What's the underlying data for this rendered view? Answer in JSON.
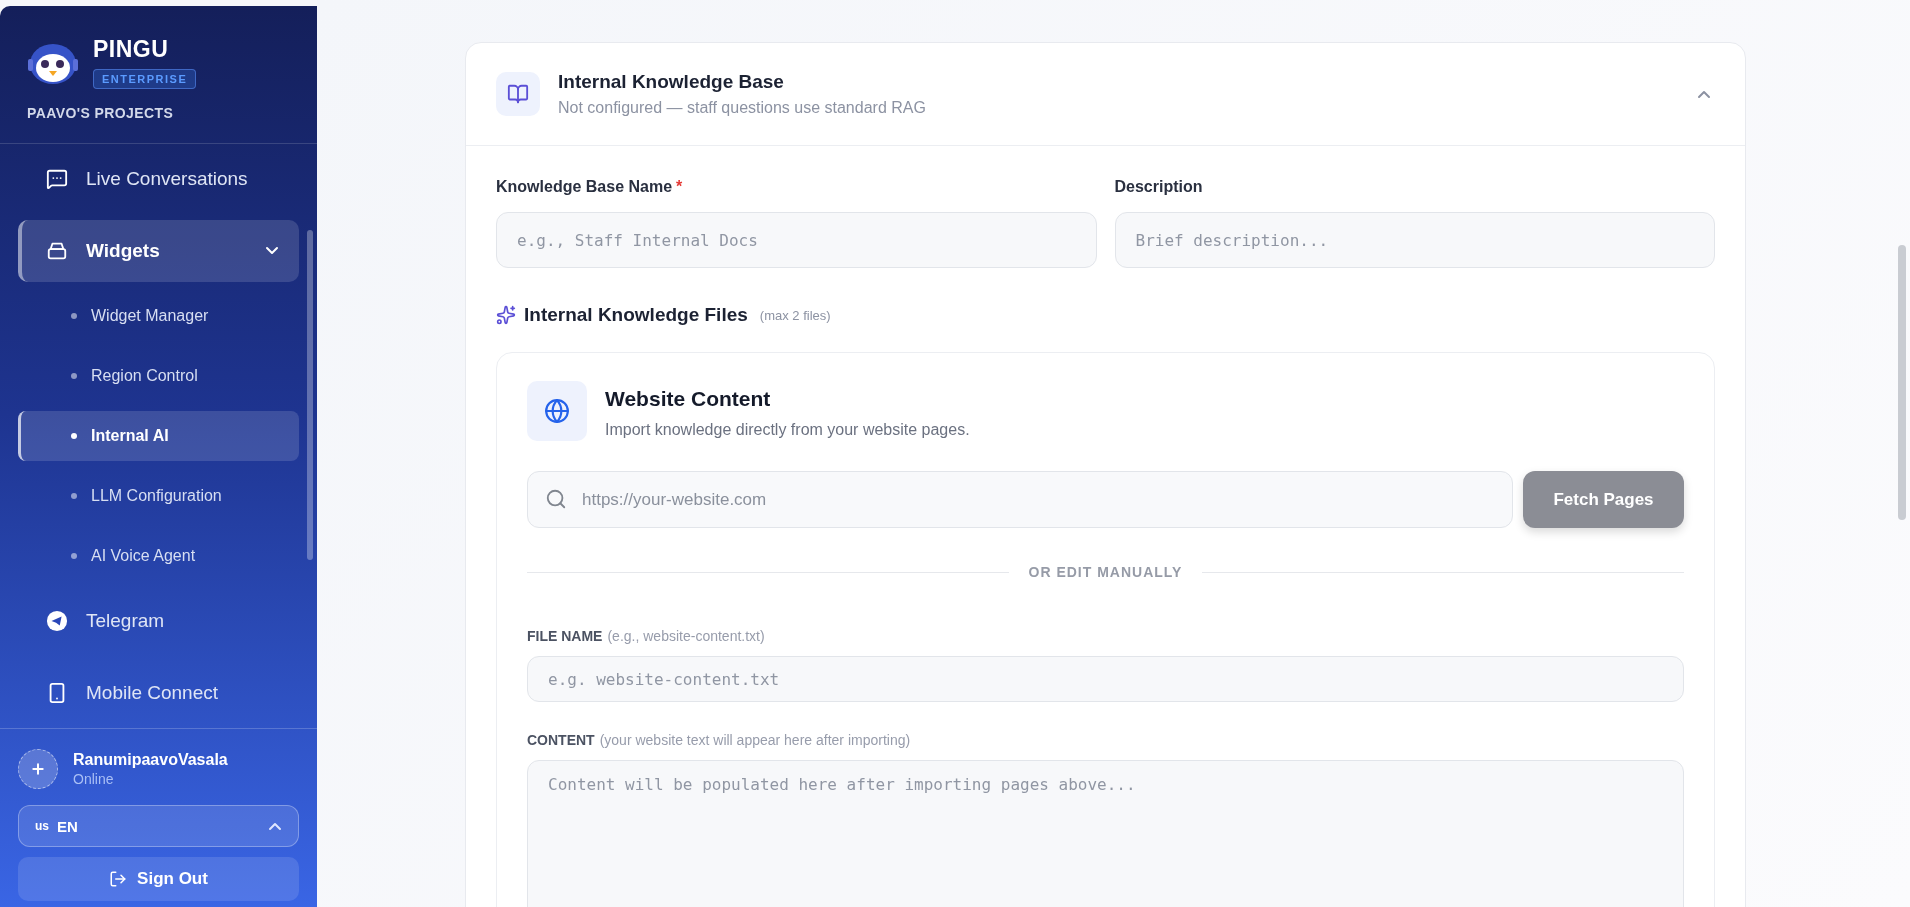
{
  "sidebar": {
    "brand": "PINGU",
    "badge": "ENTERPRISE",
    "project": "PAAVO'S PROJECTS",
    "nav": [
      {
        "label": "Live Conversations",
        "selected": false
      },
      {
        "label": "Widgets",
        "selected": true,
        "expanded": true,
        "children": [
          {
            "label": "Widget Manager",
            "selected": false
          },
          {
            "label": "Region Control",
            "selected": false
          },
          {
            "label": "Internal AI",
            "selected": true
          },
          {
            "label": "LLM Configuration",
            "selected": false
          },
          {
            "label": "AI Voice Agent",
            "selected": false
          }
        ]
      },
      {
        "label": "Telegram",
        "selected": false
      },
      {
        "label": "Mobile Connect",
        "selected": false
      }
    ],
    "user": {
      "name": "RanumipaavoVasala",
      "status": "Online"
    },
    "language": {
      "flag": "us",
      "code": "EN"
    },
    "sign_out": "Sign Out"
  },
  "panel": {
    "title": "Internal Knowledge Base",
    "subtitle": "Not configured — staff questions use standard RAG",
    "expanded": true,
    "fields": [
      {
        "label": "Knowledge Base Name",
        "required_mark": "*",
        "placeholder": "e.g., Staff Internal Docs"
      },
      {
        "label": "Description",
        "placeholder": "Brief description..."
      }
    ],
    "files": {
      "title": "Internal Knowledge Files",
      "hint": "(max 2 files)"
    },
    "source": {
      "title": "Website Content",
      "subtitle": "Import knowledge directly from your website pages.",
      "url_placeholder": "https://your-website.com",
      "fetch_button": {
        "label": "Fetch Pages",
        "disabled": true
      },
      "divider": "OR EDIT MANUALLY",
      "file_name": {
        "label": "FILE NAME",
        "hint": "(e.g., website-content.txt)",
        "placeholder": "e.g. website-content.txt"
      },
      "content": {
        "label": "CONTENT",
        "hint": "(your website text will appear here after importing)",
        "placeholder": "Content will be populated here after importing pages above..."
      }
    }
  }
}
